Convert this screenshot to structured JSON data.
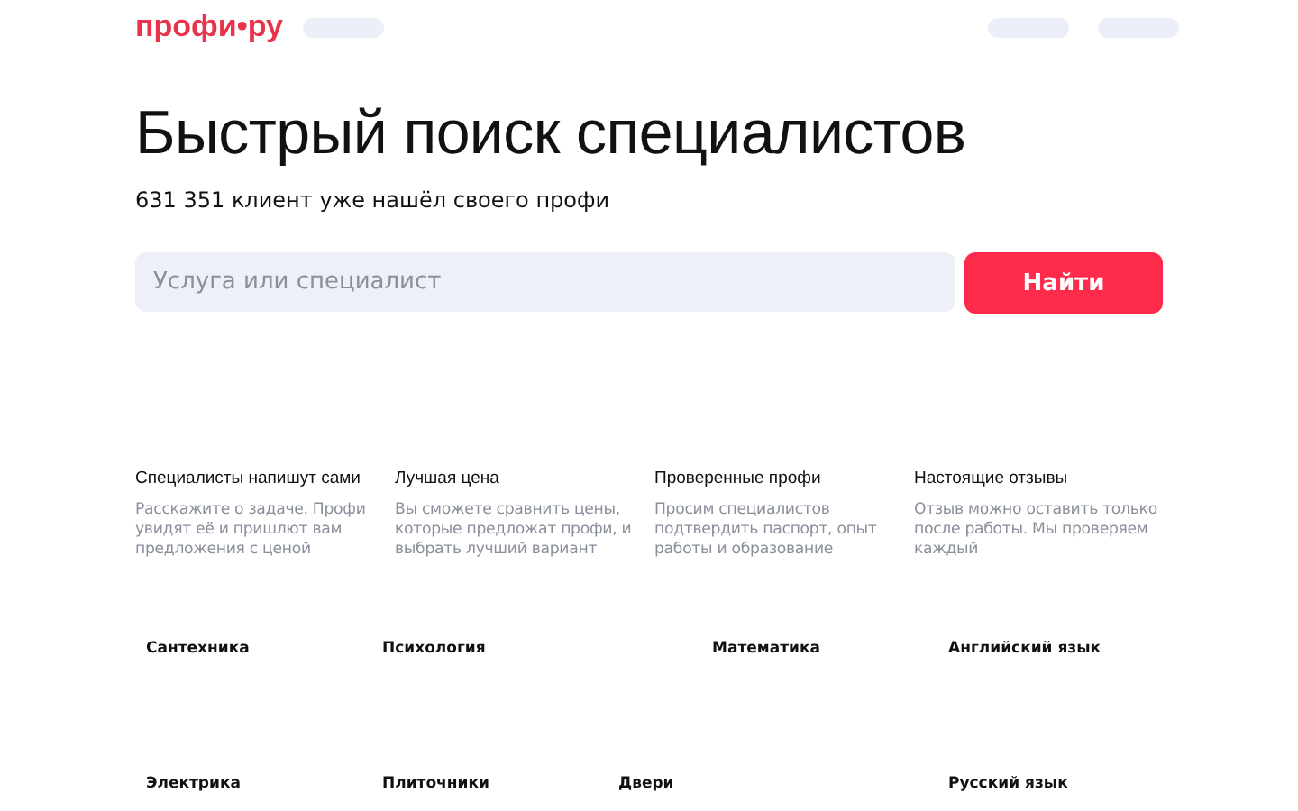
{
  "header": {
    "logo": "профи•ру"
  },
  "hero": {
    "title": "Быстрый поиск специалистов",
    "subtitle": "631 351 клиент уже нашёл своего профи"
  },
  "search": {
    "placeholder": "Услуга или специалист",
    "button": "Найти"
  },
  "features": [
    {
      "title": "Специалисты напишут сами",
      "text": "Расскажите о задаче. Профи увидят её и пришлют вам предложения с ценой"
    },
    {
      "title": "Лучшая цена",
      "text": "Вы сможете сравнить цены, которые предложат профи, и выбрать лучший вариант"
    },
    {
      "title": "Проверенные профи",
      "text": "Просим специалистов подтвердить паспорт, опыт работы и образование"
    },
    {
      "title": "Настоящие отзывы",
      "text": "Отзыв можно оставить только после работы. Мы проверяем каждый"
    }
  ],
  "categories": [
    [
      "Сантехника",
      "Психология",
      "Математика",
      "Английский язык"
    ],
    [
      "Электрика",
      "Плиточники",
      "Двери",
      "Русский язык"
    ]
  ]
}
